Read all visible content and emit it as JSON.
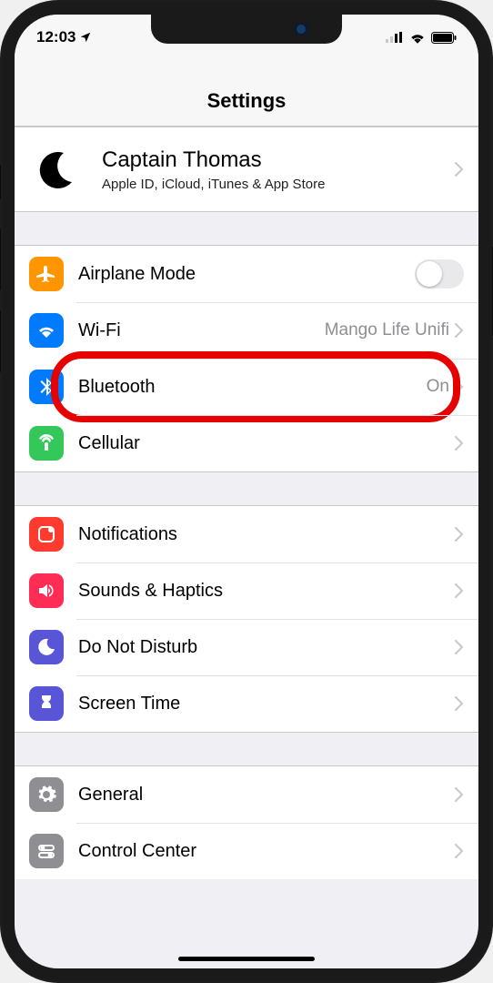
{
  "status": {
    "time": "12:03"
  },
  "header": {
    "title": "Settings"
  },
  "profile": {
    "name": "Captain Thomas",
    "subtitle": "Apple ID, iCloud, iTunes & App Store"
  },
  "sections": {
    "airplane": {
      "label": "Airplane Mode"
    },
    "wifi": {
      "label": "Wi-Fi",
      "detail": "Mango Life Unifi"
    },
    "bluetooth": {
      "label": "Bluetooth",
      "detail": "On"
    },
    "cellular": {
      "label": "Cellular"
    },
    "notifications": {
      "label": "Notifications"
    },
    "sounds": {
      "label": "Sounds & Haptics"
    },
    "dnd": {
      "label": "Do Not Disturb"
    },
    "screentime": {
      "label": "Screen Time"
    },
    "general": {
      "label": "General"
    },
    "controlcenter": {
      "label": "Control Center"
    }
  }
}
